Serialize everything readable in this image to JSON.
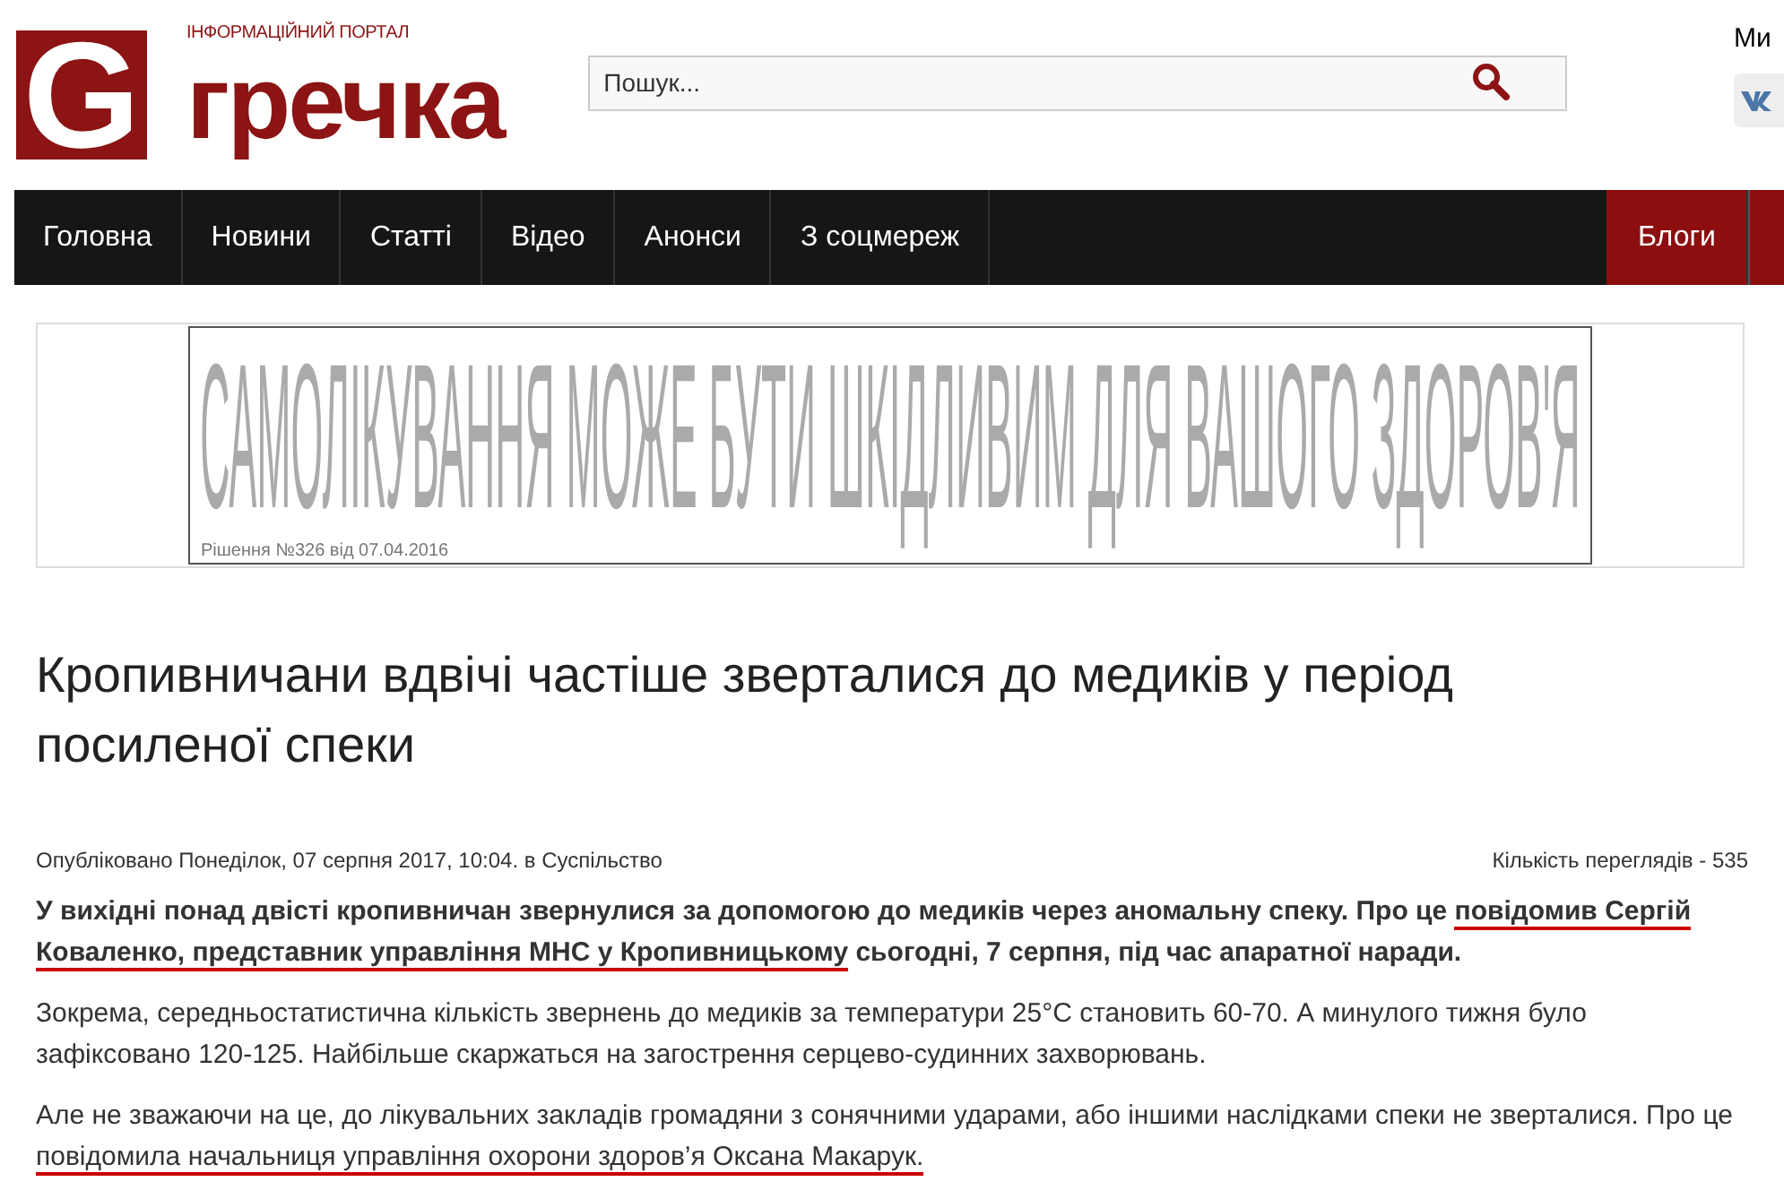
{
  "logo": {
    "letter": "G",
    "tagline": "ІНФОРМАЦІЙНИЙ ПОРТАЛ",
    "name": "гречка"
  },
  "search": {
    "placeholder": "Пошук..."
  },
  "social": {
    "label": "Ми"
  },
  "nav": [
    {
      "label": "Головна",
      "highlighted": false
    },
    {
      "label": "Новини",
      "highlighted": false
    },
    {
      "label": "Статті",
      "highlighted": false
    },
    {
      "label": "Відео",
      "highlighted": false
    },
    {
      "label": "Анонси",
      "highlighted": false
    },
    {
      "label": "З соцмереж",
      "highlighted": false
    },
    {
      "label": "Блоги",
      "highlighted": true
    }
  ],
  "banner": {
    "headline": "САМОЛІКУВАННЯ МОЖЕ БУТИ ШКІДЛИВИМ ДЛЯ ВАШОГО ЗДОРОВ'Я",
    "caption": "Рішення №326 від 07.04.2016"
  },
  "article": {
    "title": "Кропивничани вдвічі частіше зверталися до медиків у період посиленої спеки",
    "published": "Опубліковано Понеділок, 07 серпня 2017, 10:04. в Суспільство",
    "views": "Кількість переглядів - 535",
    "paragraphs": [
      {
        "bold": true,
        "segments": [
          {
            "text": "У вихідні понад двісті кропивничан звернулися за допомогою до медиків через аномальну спеку. Про це ",
            "underlined": false
          },
          {
            "text": "повідомив Сергій Коваленко, представник управління МНС у Кропивницькому",
            "underlined": true
          },
          {
            "text": " сьогодні, 7 серпня, під час апаратної наради.",
            "underlined": false
          }
        ]
      },
      {
        "bold": false,
        "segments": [
          {
            "text": "Зокрема, середньостатистична кількість звернень до медиків за температури 25°С становить 60-70. А минулого тижня було зафіксовано 120-125. Найбільше скаржаться на загострення серцево-судинних захворювань.",
            "underlined": false
          }
        ]
      },
      {
        "bold": false,
        "segments": [
          {
            "text": "Але не зважаючи на це, до лікувальних закладів громадяни з сонячними ударами, або іншими наслідками спеки не зверталися. Про це ",
            "underlined": false
          },
          {
            "text": "повідомила начальниця управління охорони здоров’я Оксана Макарук.",
            "underlined": true
          }
        ]
      }
    ]
  }
}
